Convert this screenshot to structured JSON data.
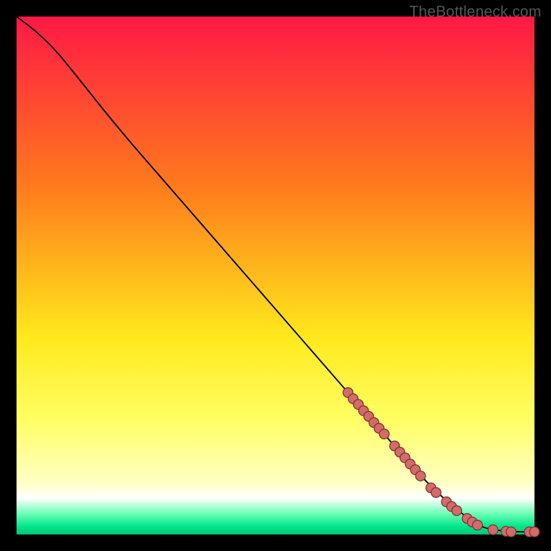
{
  "watermark": "TheBottleneck.com",
  "colors": {
    "background": "#000000",
    "line": "#000000",
    "marker_fill": "#d56a6a",
    "marker_stroke": "#7a3636",
    "gradient_stops": [
      {
        "offset": 0,
        "color": "#ff1846"
      },
      {
        "offset": 33,
        "color": "#ff7b1c"
      },
      {
        "offset": 62,
        "color": "#ffe91c"
      },
      {
        "offset": 78,
        "color": "#ffff64"
      },
      {
        "offset": 90,
        "color": "#ffffc4"
      },
      {
        "offset": 93,
        "color": "#ffffff"
      },
      {
        "offset": 96,
        "color": "#6bffb4"
      },
      {
        "offset": 98.5,
        "color": "#00e58b"
      },
      {
        "offset": 100,
        "color": "#00c777"
      }
    ]
  },
  "chart_data": {
    "type": "line",
    "title": "",
    "xlabel": "",
    "ylabel": "",
    "xlim": [
      0,
      100
    ],
    "ylim": [
      0,
      100
    ],
    "grid": false,
    "legend": false,
    "series": [
      {
        "name": "curve",
        "x": [
          0,
          4,
          8,
          12,
          20,
          30,
          40,
          50,
          60,
          70,
          80,
          88,
          90,
          92,
          96,
          100
        ],
        "y": [
          100,
          97,
          93,
          88,
          78,
          66.5,
          55,
          43.5,
          32,
          20.5,
          9,
          2.4,
          1.4,
          0.9,
          0.5,
          0.5
        ]
      }
    ],
    "markers": [
      {
        "x": 64.0,
        "y": 27.4
      },
      {
        "x": 65.0,
        "y": 26.2
      },
      {
        "x": 66.0,
        "y": 25.1
      },
      {
        "x": 67.0,
        "y": 23.9
      },
      {
        "x": 68.0,
        "y": 22.8
      },
      {
        "x": 69.0,
        "y": 21.6
      },
      {
        "x": 70.0,
        "y": 20.5
      },
      {
        "x": 71.0,
        "y": 19.4
      },
      {
        "x": 73.0,
        "y": 17.1
      },
      {
        "x": 74.0,
        "y": 15.9
      },
      {
        "x": 75.0,
        "y": 14.8
      },
      {
        "x": 76.0,
        "y": 13.6
      },
      {
        "x": 77.0,
        "y": 12.5
      },
      {
        "x": 78.0,
        "y": 11.3
      },
      {
        "x": 80.0,
        "y": 9.0
      },
      {
        "x": 81.0,
        "y": 8.1
      },
      {
        "x": 83.0,
        "y": 6.3
      },
      {
        "x": 84.0,
        "y": 5.4
      },
      {
        "x": 85.0,
        "y": 4.6
      },
      {
        "x": 87.0,
        "y": 3.1
      },
      {
        "x": 88.0,
        "y": 2.4
      },
      {
        "x": 89.0,
        "y": 1.8
      },
      {
        "x": 92.0,
        "y": 0.9
      },
      {
        "x": 94.5,
        "y": 0.6
      },
      {
        "x": 95.5,
        "y": 0.5
      },
      {
        "x": 99.0,
        "y": 0.5
      },
      {
        "x": 100.0,
        "y": 0.5
      }
    ]
  }
}
